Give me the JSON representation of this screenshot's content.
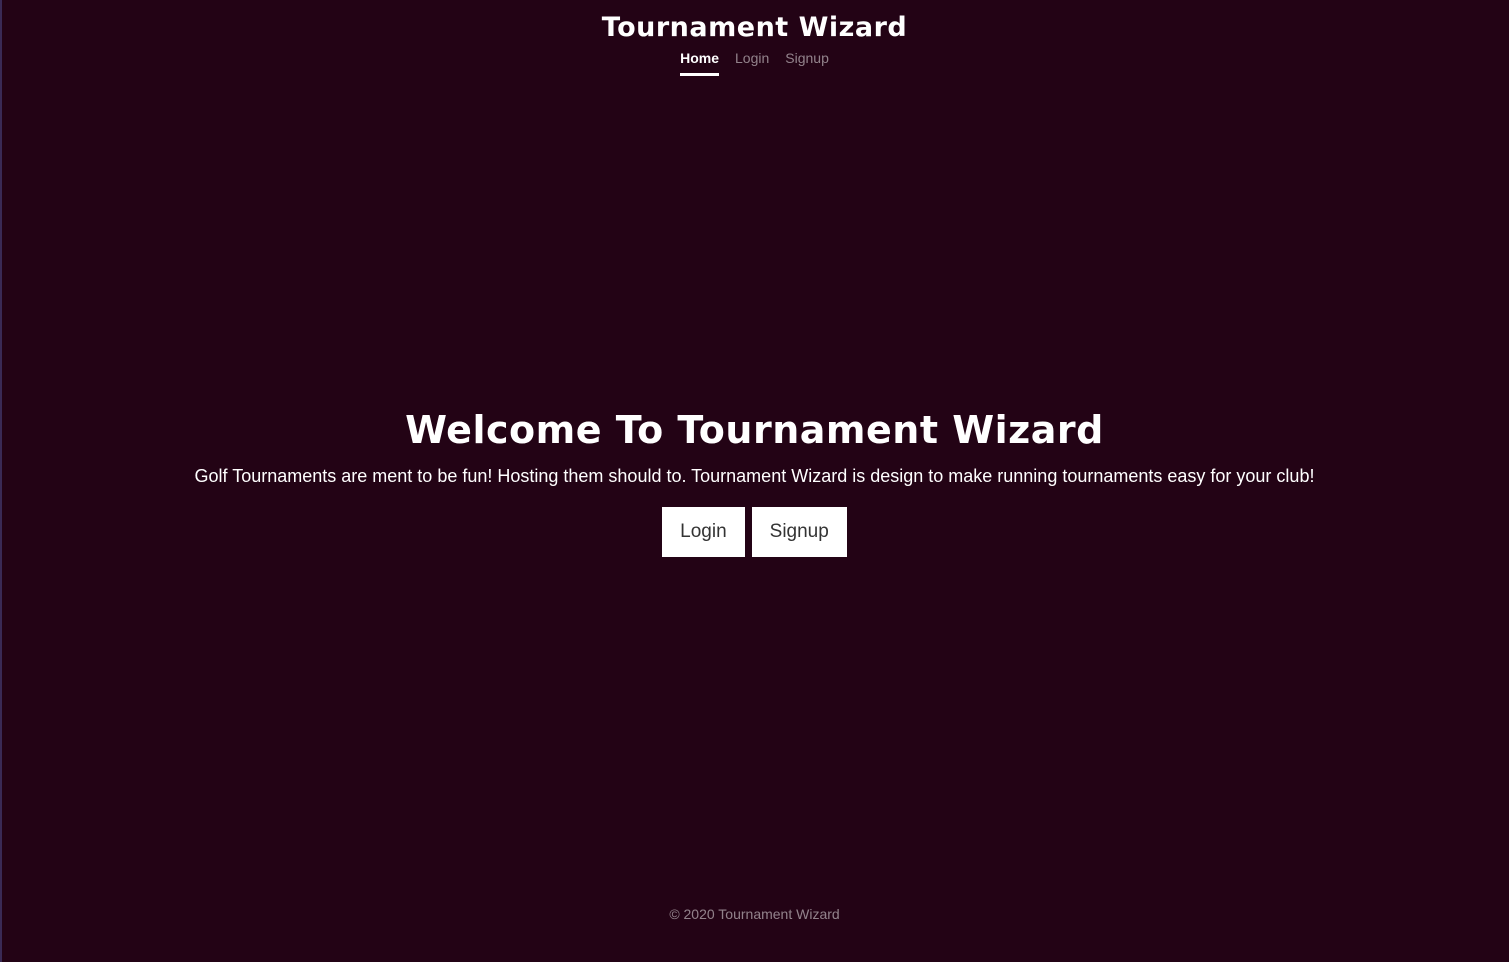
{
  "header": {
    "brand": "Tournament Wizard",
    "nav": [
      {
        "label": "Home",
        "active": true
      },
      {
        "label": "Login",
        "active": false
      },
      {
        "label": "Signup",
        "active": false
      }
    ]
  },
  "hero": {
    "title": "Welcome To Tournament Wizard",
    "lead": "Golf Tournaments are ment to be fun! Hosting them should to. Tournament Wizard is design to make running tournaments easy for your club!",
    "buttons": {
      "login_label": "Login",
      "signup_label": "Signup"
    }
  },
  "footer": {
    "copyright": "© 2020 Tournament Wizard"
  },
  "colors": {
    "background": "#230315",
    "text": "#ffffff",
    "muted_text": "rgba(255,255,255,0.5)",
    "button_bg": "#ffffff",
    "button_text": "#333333"
  }
}
